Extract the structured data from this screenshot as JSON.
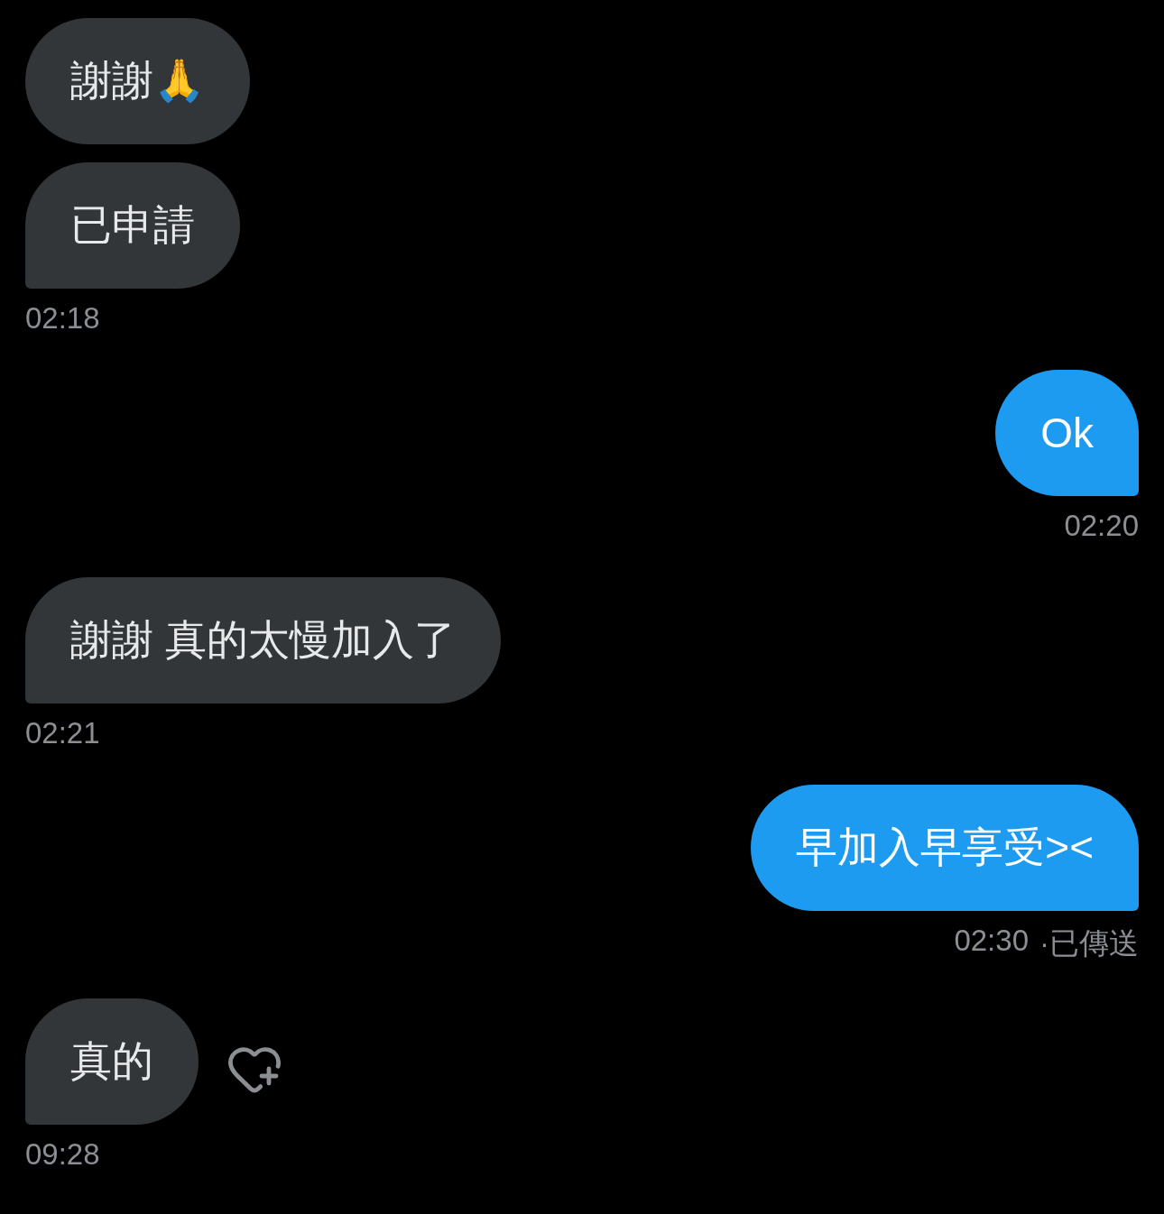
{
  "messages": [
    {
      "kind": "received",
      "bubbles": [
        "謝謝🙏",
        "已申請"
      ],
      "time": "02:18"
    },
    {
      "kind": "sent",
      "bubbles": [
        "Ok"
      ],
      "time": "02:20"
    },
    {
      "kind": "received",
      "bubbles": [
        "謝謝 真的太慢加入了"
      ],
      "time": "02:21"
    },
    {
      "kind": "sent",
      "bubbles": [
        "早加入早享受><"
      ],
      "time": "02:30",
      "status": "·已傳送"
    },
    {
      "kind": "received",
      "bubbles": [
        "真的"
      ],
      "time": "09:28",
      "reaction_button": true
    }
  ]
}
